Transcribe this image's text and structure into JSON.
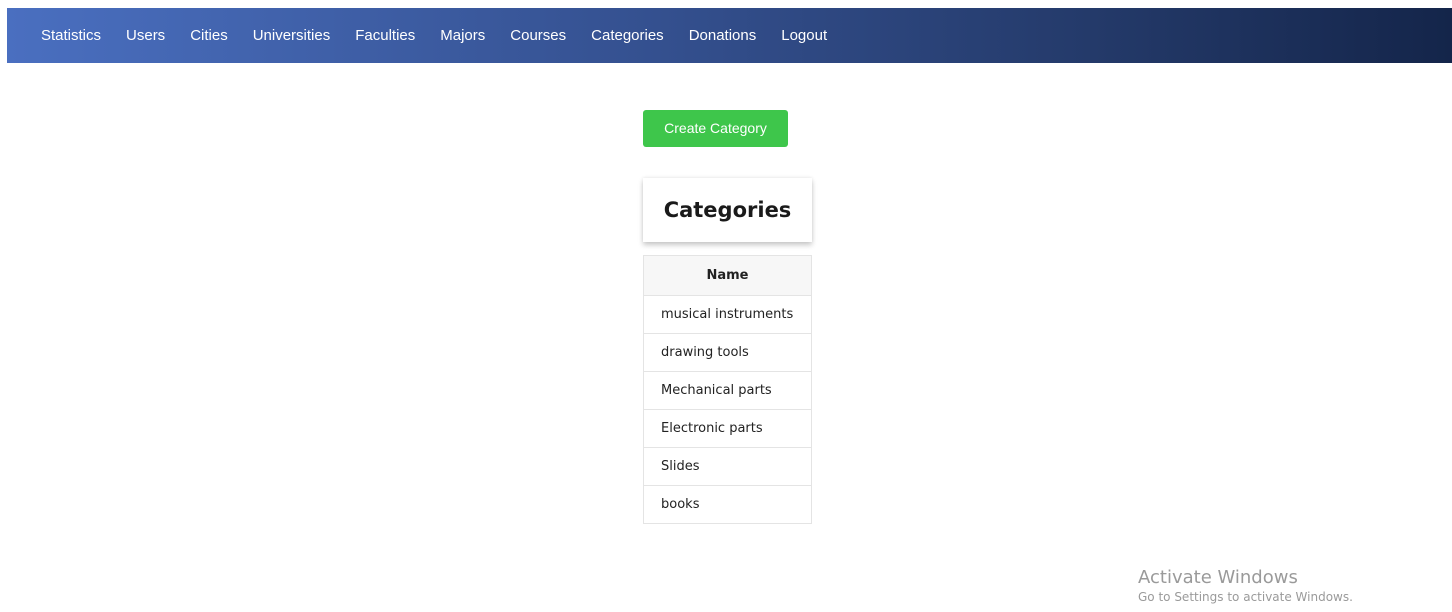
{
  "nav": {
    "items": [
      "Statistics",
      "Users",
      "Cities",
      "Universities",
      "Faculties",
      "Majors",
      "Courses",
      "Categories",
      "Donations",
      "Logout"
    ]
  },
  "actions": {
    "create_label": "Create Category"
  },
  "page": {
    "title": "Categories"
  },
  "table": {
    "header": "Name",
    "rows": [
      "musical instruments",
      "drawing tools",
      "Mechanical parts",
      "Electronic parts",
      "Slides",
      "books"
    ]
  },
  "watermark": {
    "title": "Activate Windows",
    "subtitle": "Go to Settings to activate Windows."
  },
  "colors": {
    "nav_start": "#4a6fc0",
    "nav_end": "#14254a",
    "create_button": "#3ec64b"
  }
}
